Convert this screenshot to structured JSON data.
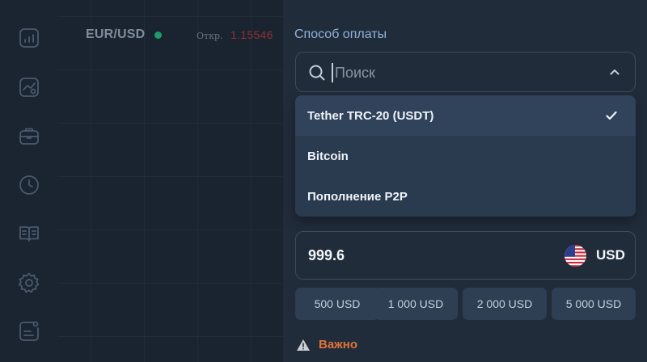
{
  "sidebar": {
    "icons": [
      "chart-icon",
      "analytics-icon",
      "portfolio-icon",
      "clock-icon",
      "book-icon",
      "gear-icon",
      "notes-icon"
    ]
  },
  "chart": {
    "pair": "EUR/USD",
    "open_label": "Откр.",
    "open_value": "1.15546",
    "colors": {
      "status_dot": "#1f9a6c",
      "open_value": "#8d3232"
    }
  },
  "payment": {
    "title": "Способ оплаты",
    "search_placeholder": "Поиск",
    "options": [
      {
        "label": "Tether TRC-20 (USDT)",
        "selected": true
      },
      {
        "label": "Bitcoin",
        "selected": false
      },
      {
        "label": "Пополнение P2P",
        "selected": false
      }
    ]
  },
  "amount": {
    "value": "999.6",
    "currency": "USD",
    "flag": "us-flag-icon"
  },
  "quick_amounts": [
    "500 USD",
    "1 000 USD",
    "2 000 USD",
    "5 000 USD"
  ],
  "notice": {
    "text": "Важно",
    "color": "#e0733a"
  }
}
